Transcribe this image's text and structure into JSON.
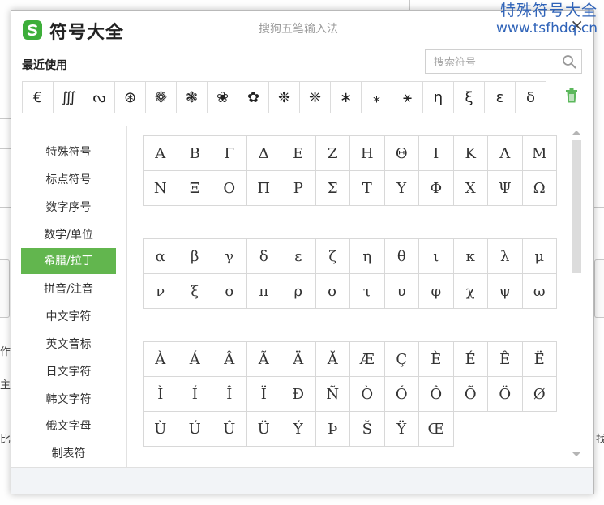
{
  "watermark": {
    "line1": "特殊符号大全",
    "line2": "www.tsfhdq.cn"
  },
  "background": {
    "frag1": "作",
    "frag2": "主",
    "frag3": "比",
    "frag4": "找"
  },
  "window": {
    "title": "符号大全",
    "app_name": "搜狗五笔输入法",
    "close_icon": "×"
  },
  "recent": {
    "label": "最近使用",
    "symbols": [
      "€",
      "∭",
      "ᔓ",
      "⊛",
      "❁",
      "❃",
      "❀",
      "✿",
      "❉",
      "❈",
      "∗",
      "⁎",
      "⚹",
      "η",
      "ξ",
      "ε",
      "δ"
    ]
  },
  "search": {
    "placeholder": "搜索符号"
  },
  "categories": [
    "特殊符号",
    "标点符号",
    "数字序号",
    "数学/单位",
    "希腊/拉丁",
    "拼音/注音",
    "中文字符",
    "英文音标",
    "日文字符",
    "韩文字符",
    "俄文字母",
    "制表符"
  ],
  "active_category_index": 4,
  "grids": {
    "greek_upper": [
      "Α",
      "Β",
      "Γ",
      "Δ",
      "Ε",
      "Ζ",
      "Η",
      "Θ",
      "Ι",
      "Κ",
      "Λ",
      "Μ",
      "Ν",
      "Ξ",
      "Ο",
      "Π",
      "Ρ",
      "Σ",
      "Τ",
      "Υ",
      "Φ",
      "Χ",
      "Ψ",
      "Ω"
    ],
    "greek_lower": [
      "α",
      "β",
      "γ",
      "δ",
      "ε",
      "ζ",
      "η",
      "θ",
      "ι",
      "κ",
      "λ",
      "μ",
      "ν",
      "ξ",
      "ο",
      "π",
      "ρ",
      "σ",
      "τ",
      "υ",
      "φ",
      "χ",
      "ψ",
      "ω"
    ],
    "latin": [
      "À",
      "Á",
      "Â",
      "Ã",
      "Ä",
      "Ă",
      "Æ",
      "Ç",
      "È",
      "É",
      "Ê",
      "Ë",
      "Ì",
      "Í",
      "Î",
      "Ï",
      "Đ",
      "Ñ",
      "Ò",
      "Ó",
      "Ô",
      "Õ",
      "Ö",
      "Ø",
      "Ù",
      "Ú",
      "Û",
      "Ü",
      "Ý",
      "Þ",
      "Š",
      "Ÿ",
      "Œ"
    ]
  },
  "colors": {
    "accent": "#62b64e",
    "logo": "#3dae3a",
    "watermark": "#2f63b8"
  }
}
